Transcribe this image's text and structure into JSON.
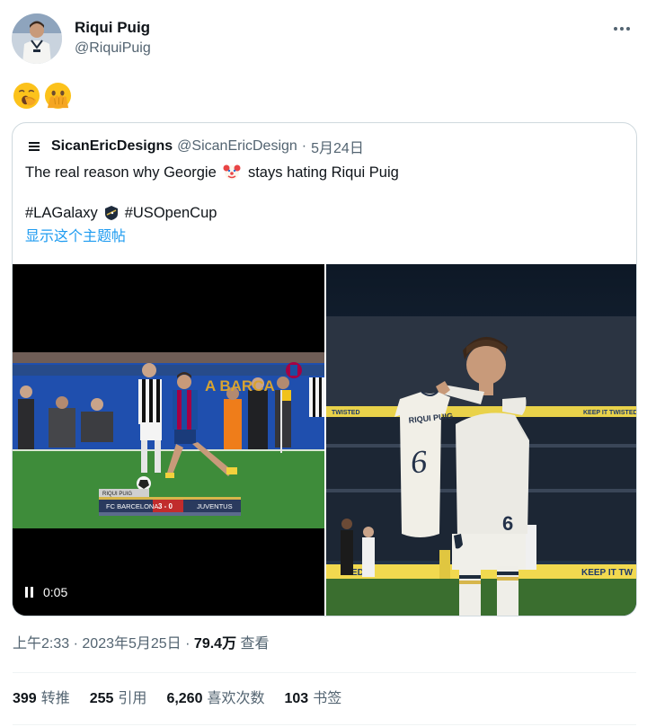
{
  "author": {
    "name": "Riqui Puig",
    "handle": "@RiquiPuig"
  },
  "tweet": {
    "emojis": [
      "yawning-face-icon",
      "face-with-hand-over-mouth-icon"
    ]
  },
  "quote": {
    "name": "SicanEricDesigns",
    "handle": "@SicanEricDesign",
    "separator": "·",
    "date": "5月24日",
    "text_before": "The real reason why Georgie",
    "text_after": "stays hating Riqui Puig",
    "hashtag1": "#LAGalaxy",
    "hashtag2": "#USOpenCup",
    "show_thread": "显示这个主题帖",
    "video_time": "0:05",
    "scoreboard": {
      "home": "FC BARCELONA",
      "score": "3 - 0",
      "away": "JUVENTUS",
      "top": "RIQUI PUIG"
    },
    "stadium_text": "A BARCA",
    "jersey_name": "RIQUI PUIG",
    "jersey_number": "6",
    "banner": "KEEP IT TW",
    "banner2": "ED"
  },
  "meta": {
    "time": "上午2:33",
    "dot": "·",
    "date": "2023年5月25日",
    "views_num": "79.4万",
    "views_label": "查看"
  },
  "stats": {
    "retweets": "399",
    "retweets_label": "转推",
    "quotes": "255",
    "quotes_label": "引用",
    "likes": "6,260",
    "likes_label": "喜欢次数",
    "bookmarks": "103",
    "bookmarks_label": "书签"
  },
  "colors": {
    "link": "#1d9bf0",
    "secondary_text": "#536471",
    "primary_text": "#0f1419",
    "border": "#cfd9de"
  }
}
